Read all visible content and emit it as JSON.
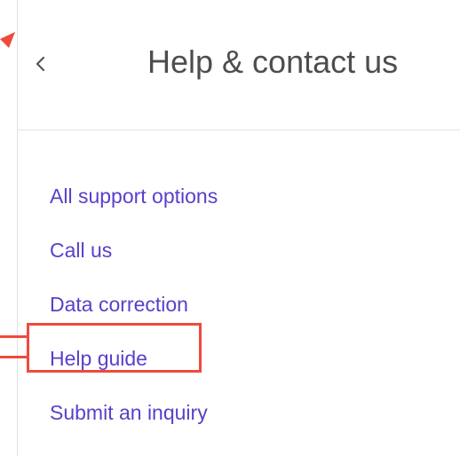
{
  "panel": {
    "back_icon": "chevron-left-icon",
    "title": "Help & contact us"
  },
  "links": [
    {
      "label": "All support options"
    },
    {
      "label": "Call us"
    },
    {
      "label": "Data correction"
    },
    {
      "label": "Help guide",
      "highlighted": true
    },
    {
      "label": "Submit an inquiry"
    }
  ],
  "colors": {
    "link": "#5b3fc9",
    "title": "#4d4d4d",
    "annotation": "#ef4a3c"
  }
}
